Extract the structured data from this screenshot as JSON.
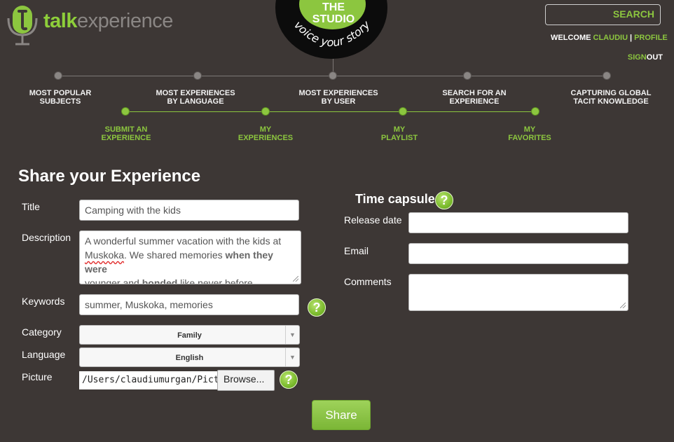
{
  "brand": {
    "logo_talk": "talk",
    "logo_experience": "experience"
  },
  "studio": {
    "line1": "THE",
    "line2": "STUDIO",
    "tagline": "voice your story"
  },
  "header": {
    "search_label": "SEARCH",
    "welcome_label": "WELCOME",
    "username": "CLAUDIU",
    "separator": "|",
    "profile_link": "PROFILE",
    "sign_label": "SIGN",
    "out_label": "OUT"
  },
  "nav": {
    "top": [
      {
        "line1": "MOST POPULAR",
        "line2": "SUBJECTS"
      },
      {
        "line1": "MOST EXPERIENCES",
        "line2": "BY LANGUAGE"
      },
      {
        "line1": "MOST EXPERIENCES",
        "line2": "BY USER"
      },
      {
        "line1": "SEARCH FOR AN",
        "line2": "EXPERIENCE"
      },
      {
        "line1": "CAPTURING GLOBAL",
        "line2": "TACIT KNOWLEDGE"
      }
    ],
    "bottom": [
      {
        "line1": "SUBMIT AN",
        "line2": "EXPERIENCE"
      },
      {
        "line1": "MY",
        "line2": "EXPERIENCES"
      },
      {
        "line1": "MY",
        "line2": "PLAYLIST"
      },
      {
        "line1": "MY",
        "line2": "FAVORITES"
      }
    ]
  },
  "form": {
    "heading": "Share your Experience",
    "title_label": "Title",
    "title_value": "Camping with the kids",
    "description_label": "Description",
    "description_line1": "A wonderful summer vacation with the kids at",
    "description_line2_a": "Muskoka",
    "description_line2_b": ". We shared memories ",
    "description_line2_c": "when they were",
    "description_line3_a": "younger and  ",
    "description_line3_b": "bonded",
    "description_line3_c": " like never before",
    "keywords_label": "Keywords",
    "keywords_value": "summer, Muskoka, memories",
    "category_label": "Category",
    "category_value": "Family",
    "language_label": "Language",
    "language_value": "English",
    "picture_label": "Picture",
    "picture_path": "/Users/claudiumurgan/Pictu",
    "browse_label": "Browse...",
    "help_glyph": "?",
    "share_label": "Share"
  },
  "time_capsule": {
    "heading": "Time capsule",
    "release_label": "Release date",
    "release_value": "",
    "email_label": "Email",
    "email_value": "",
    "comments_label": "Comments",
    "comments_value": ""
  },
  "colors": {
    "background": "#3d3735",
    "accent": "#8cc63f",
    "badge": "#0c0c0c"
  }
}
